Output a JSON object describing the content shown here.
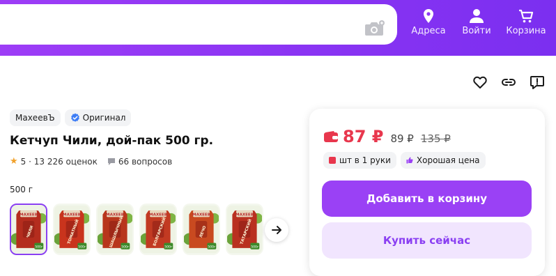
{
  "header": {
    "nav": [
      {
        "label": "Адреса",
        "icon": "location-pin-icon"
      },
      {
        "label": "Войти",
        "icon": "user-icon"
      },
      {
        "label": "Корзина",
        "icon": "cart-icon"
      }
    ],
    "search": {
      "icon": "camera-search-icon"
    }
  },
  "actions": [
    "heart-icon",
    "link-icon",
    "report-icon"
  ],
  "product": {
    "brand": "МахеевЪ",
    "original_label": "Оригинал",
    "title": "Кетчуп Чили, дой-пак 500 гр.",
    "rating_text": "5 · 13 226 оценок",
    "questions_text": "66 вопросов",
    "variant": "500 г",
    "thumbnails": [
      {
        "label": "ЧИЛИ",
        "brand": "МАХЕЕВ",
        "size": "500г",
        "color": "#b42d1e",
        "active": true
      },
      {
        "label": "ТОМАТНЫЙ",
        "brand": "МАХЕЕВ",
        "size": "500г",
        "color": "#c9341d",
        "active": false
      },
      {
        "label": "ШАШЛЫЧНЫЙ",
        "brand": "МАХЕЕВ",
        "size": "500г",
        "color": "#b8361c",
        "active": false
      },
      {
        "label": "БОЛГАРСКИЙ",
        "brand": "МАХЕЕВ",
        "size": "500г",
        "color": "#c23a22",
        "active": false
      },
      {
        "label": "ЛЕЧО",
        "brand": "МАХЕЕВ",
        "size": "500г",
        "color": "#c94a20",
        "active": false
      },
      {
        "label": "ТАТАРСКИЙ",
        "brand": "МАХЕЕВ",
        "size": "500г",
        "color": "#b93020",
        "active": false
      }
    ]
  },
  "offer": {
    "price": "87 ₽",
    "price_mid": "89 ₽",
    "price_old": "135 ₽",
    "badges": [
      {
        "label": "шт в 1 руки",
        "color": "#e8374d"
      },
      {
        "label": "Хорошая цена",
        "color": "#9a41f5"
      }
    ],
    "add_to_cart": "Добавить в корзину",
    "buy_now": "Купить сейчас"
  },
  "colors": {
    "accent": "#9a41f5",
    "price": "#e8374d"
  }
}
